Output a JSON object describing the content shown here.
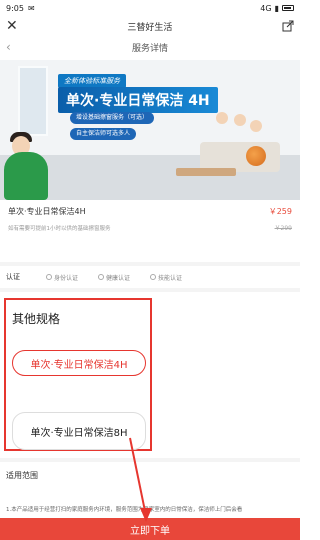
{
  "status_bar": {
    "time": "9:05",
    "signal": "4G"
  },
  "app_bar": {
    "title": "三替好生活"
  },
  "sub_bar": {
    "title": "服务详情"
  },
  "hero": {
    "slogan": "全新体验标准服务",
    "headline": "单次·专业日常保洁 4H",
    "pill_1": "增设基础擦窗服务（可选）",
    "pill_2": "自主保洁师可选多人"
  },
  "service": {
    "name": "单次·专业日常保洁4H",
    "price": "￥259",
    "note": "如有需要可提前1小时以供的基础擦窗服务",
    "original_price": "￥299"
  },
  "verify": {
    "label": "认证",
    "items": [
      "身份认证",
      "健康认证",
      "技能认证"
    ]
  },
  "spec": {
    "title": "其他规格",
    "options": [
      "单次·专业日常保洁4H",
      "单次·专业日常保洁8H"
    ]
  },
  "scope": {
    "title": "适用范围",
    "text": "1.本产品适用于经营打扫的家庭服务内环境，服务范围为房家室内的日常保洁，保洁师上门后会看"
  },
  "order_button": {
    "label": "立即下单"
  },
  "colors": {
    "accent": "#e8473a",
    "highlight_box": "#e6362f"
  }
}
